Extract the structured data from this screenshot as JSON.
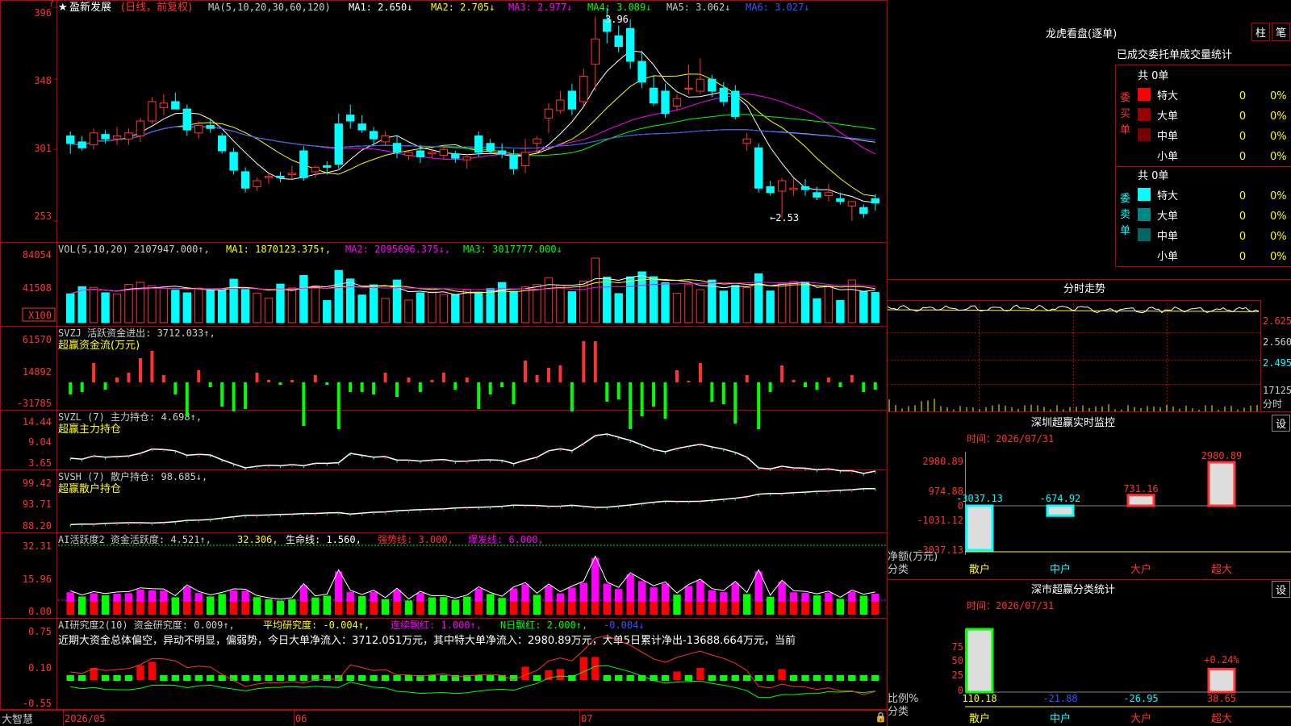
{
  "stock_title": "盈新发展",
  "stock_mode": "(日线，前复权)",
  "ma_header": {
    "label": "MA(5,10,20,30,60,120)",
    "ma1": "MA1: 2.650↓",
    "ma2": "MA2: 2.705↓",
    "ma3": "MA3: 2.977↓",
    "ma4": "MA4: 3.089↓",
    "ma5": "MA5: 3.062↓",
    "ma6": "MA6: 3.027↓"
  },
  "price_axis": [
    "396",
    "348",
    "301",
    "253"
  ],
  "price_annot": {
    "high": "3.96",
    "low": "←2.53"
  },
  "vol_header": {
    "label": "VOL(5,10,20) 2107947.000↑,",
    "ma1": "MA1: 1870123.375↑,",
    "ma2": "MA2: 2095696.375↓,",
    "ma3": "MA3: 3017777.000↓"
  },
  "vol_axis": [
    "84054",
    "41508"
  ],
  "vol_unit": "X100",
  "svzj_header": {
    "label": "SVZJ  活跃资金进出: 3712.033↑,",
    "name": "超赢资金流(万元)"
  },
  "svzj_axis": [
    "61570",
    "14892",
    "-31785"
  ],
  "svzl_header": {
    "label": "SVZL (7) 主力持仓: 4.698↑,",
    "name": "超赢主力持仓"
  },
  "svzl_axis": [
    "14.44",
    "9.04",
    "3.65"
  ],
  "svsh_header": {
    "label": "SVSH (7) 散户持仓: 98.685↓,",
    "name": "超赢散户持仓"
  },
  "svsh_axis": [
    "99.42",
    "93.71",
    "88.20"
  ],
  "ai1_header": {
    "label": "AI活跃度2 资金活跃度: 4.521↑,",
    "v2": "32.306,",
    "life": "生命线: 1.560,",
    "strong": "强势线: 3.000,",
    "burst": "爆发线: 6.000,"
  },
  "ai1_axis": [
    "32.31",
    "15.96",
    "0.00"
  ],
  "ai2_header": {
    "label": "AI研究度2(10) 资金研究度: 0.009↑,",
    "avg": "平均研究度: -0.004↑,",
    "cont": "连续飘红: 1.000↑,",
    "nday": "N日飘红: 2.000↑,",
    "last": "-0.004↓"
  },
  "ai2_text": "近期大资金总体偏空，异动不明显，偏弱势，今日大单净流入：3712.051万元，其中特大单净流入：2980.89万元，大单5日累计净出-13688.664万元，当前",
  "ai2_axis": [
    "0.75",
    "0.10",
    "-0.55"
  ],
  "date_axis": [
    "2026/05",
    "06",
    "07"
  ],
  "brand": "大智慧",
  "dragon_title": "龙虎看盘(逐单)",
  "btn_bar": "柱",
  "btn_pen": "笔",
  "order_title": "已成交委托单成交量统计",
  "buy_side": {
    "label": "委买单",
    "count": "共 0单",
    "rows": [
      {
        "name": "特大",
        "val": "0",
        "pct": "0%",
        "color": "#ff0000"
      },
      {
        "name": "大单",
        "val": "0",
        "pct": "0%",
        "color": "#990000"
      },
      {
        "name": "中单",
        "val": "0",
        "pct": "0%",
        "color": "#770000"
      },
      {
        "name": "小单",
        "val": "0",
        "pct": "0%",
        "color": "#000000"
      }
    ]
  },
  "sell_side": {
    "label": "委卖单",
    "count": "共 0单",
    "rows": [
      {
        "name": "特大",
        "val": "0",
        "pct": "0%",
        "color": "#00ffff"
      },
      {
        "name": "大单",
        "val": "0",
        "pct": "0%",
        "color": "#008888"
      },
      {
        "name": "中单",
        "val": "0",
        "pct": "0%",
        "color": "#006666"
      },
      {
        "name": "小单",
        "val": "0",
        "pct": "0%",
        "color": "#000000"
      }
    ]
  },
  "intraday_title": "分时走势",
  "intraday_axis": [
    "2.625",
    "2.560",
    "2.495",
    "17125",
    "分时"
  ],
  "sz_monitor": {
    "title": "深圳超赢实时监控",
    "set": "设",
    "time": "时间：2026/07/31",
    "axis": [
      "2980.89",
      "974.88",
      "0",
      "-1031.12",
      "-3037.13"
    ],
    "ylabel": "净额(万元)",
    "xlabel": "分类",
    "cats": [
      "散户",
      "中户",
      "大户",
      "超大"
    ],
    "values": [
      -3037.13,
      -674.92,
      731.16,
      2980.89
    ],
    "labels": [
      "-3037.13",
      "-674.92",
      "731.16",
      "2980.89"
    ]
  },
  "sz_class": {
    "title": "深市超赢分类统计",
    "set": "设",
    "time": "时间：2026/07/31",
    "axis": [
      "75",
      "50",
      "25",
      "0"
    ],
    "ylabel": "比例%",
    "xlabel": "分类",
    "cats": [
      "散户",
      "中户",
      "大户",
      "超大"
    ],
    "values": [
      110.18,
      -21.88,
      -26.95,
      38.65
    ],
    "labels": [
      "110.18",
      "-21.88",
      "-26.95",
      "38.65"
    ],
    "annot": "+0.24%"
  },
  "colors": {
    "up": "#ff3333",
    "down": "#00ffff",
    "grid": "#c00000",
    "ma1": "#ffffff",
    "ma2": "#ffff00",
    "ma3": "#ff00ff",
    "ma4": "#00ff00",
    "ma5": "#cccccc",
    "ma6": "#3355ff"
  },
  "chart_data": {
    "type": "candlestick",
    "ohlc": [
      [
        3.1,
        3.13,
        2.98,
        3.05
      ],
      [
        3.06,
        3.1,
        3.0,
        3.02
      ],
      [
        3.04,
        3.15,
        3.01,
        3.12
      ],
      [
        3.11,
        3.14,
        3.05,
        3.08
      ],
      [
        3.08,
        3.16,
        3.04,
        3.1
      ],
      [
        3.08,
        3.15,
        3.04,
        3.12
      ],
      [
        3.1,
        3.22,
        3.06,
        3.2
      ],
      [
        3.2,
        3.36,
        3.18,
        3.33
      ],
      [
        3.29,
        3.38,
        3.24,
        3.32
      ],
      [
        3.33,
        3.39,
        3.28,
        3.28
      ],
      [
        3.28,
        3.31,
        3.1,
        3.14
      ],
      [
        3.12,
        3.2,
        3.08,
        3.17
      ],
      [
        3.17,
        3.21,
        3.12,
        3.15
      ],
      [
        3.1,
        3.12,
        2.98,
        3.0
      ],
      [
        2.99,
        3.02,
        2.84,
        2.87
      ],
      [
        2.86,
        2.89,
        2.72,
        2.75
      ],
      [
        2.76,
        2.82,
        2.73,
        2.8
      ],
      [
        2.82,
        2.85,
        2.78,
        2.83
      ],
      [
        2.83,
        2.86,
        2.79,
        2.82
      ],
      [
        2.84,
        2.9,
        2.81,
        2.85
      ],
      [
        3.0,
        3.03,
        2.8,
        2.82
      ],
      [
        2.86,
        2.9,
        2.82,
        2.89
      ],
      [
        2.9,
        2.93,
        2.84,
        2.89
      ],
      [
        3.18,
        3.25,
        2.88,
        2.91
      ],
      [
        3.24,
        3.31,
        3.15,
        3.2
      ],
      [
        3.18,
        3.24,
        3.12,
        3.14
      ],
      [
        3.13,
        3.16,
        3.04,
        3.08
      ],
      [
        3.06,
        3.13,
        3.04,
        3.1
      ],
      [
        3.05,
        3.1,
        2.95,
        2.99
      ],
      [
        2.97,
        3.0,
        2.94,
        2.99
      ],
      [
        3.0,
        3.04,
        2.92,
        2.96
      ],
      [
        2.98,
        3.02,
        2.95,
        2.99
      ],
      [
        2.97,
        3.03,
        2.94,
        3.01
      ],
      [
        2.98,
        3.0,
        2.92,
        2.95
      ],
      [
        2.94,
        2.98,
        2.88,
        2.96
      ],
      [
        3.1,
        3.13,
        2.96,
        2.99
      ],
      [
        3.05,
        3.08,
        2.98,
        3.0
      ],
      [
        3.0,
        3.05,
        2.95,
        2.98
      ],
      [
        2.97,
        3.01,
        2.84,
        2.88
      ],
      [
        2.9,
        3.08,
        2.85,
        2.99
      ],
      [
        3.05,
        3.1,
        2.98,
        3.08
      ],
      [
        3.22,
        3.32,
        3.12,
        3.28
      ],
      [
        3.27,
        3.4,
        3.25,
        3.34
      ],
      [
        3.4,
        3.45,
        3.24,
        3.28
      ],
      [
        3.33,
        3.55,
        3.3,
        3.5
      ],
      [
        3.58,
        3.9,
        3.4,
        3.75
      ],
      [
        3.88,
        3.96,
        3.72,
        3.8
      ],
      [
        3.77,
        3.84,
        3.66,
        3.7
      ],
      [
        3.82,
        3.88,
        3.55,
        3.6
      ],
      [
        3.6,
        3.67,
        3.42,
        3.46
      ],
      [
        3.42,
        3.5,
        3.3,
        3.32
      ],
      [
        3.4,
        3.45,
        3.22,
        3.25
      ],
      [
        3.3,
        3.38,
        3.27,
        3.35
      ],
      [
        3.42,
        3.58,
        3.38,
        3.42
      ],
      [
        3.4,
        3.62,
        3.38,
        3.48
      ],
      [
        3.48,
        3.51,
        3.36,
        3.4
      ],
      [
        3.42,
        3.46,
        3.3,
        3.33
      ],
      [
        3.4,
        3.44,
        3.21,
        3.23
      ],
      [
        3.05,
        3.12,
        3.0,
        3.08
      ],
      [
        3.02,
        3.05,
        2.72,
        2.75
      ],
      [
        2.76,
        2.8,
        2.7,
        2.72
      ],
      [
        2.73,
        2.82,
        2.55,
        2.8
      ],
      [
        2.74,
        2.82,
        2.7,
        2.75
      ],
      [
        2.76,
        2.81,
        2.7,
        2.74
      ],
      [
        2.72,
        2.76,
        2.67,
        2.69
      ],
      [
        2.7,
        2.78,
        2.66,
        2.72
      ],
      [
        2.68,
        2.72,
        2.64,
        2.66
      ],
      [
        2.63,
        2.66,
        2.53,
        2.66
      ],
      [
        2.62,
        2.64,
        2.55,
        2.58
      ],
      [
        2.68,
        2.71,
        2.6,
        2.65
      ]
    ],
    "price_range": [
      2.4,
      4.0
    ]
  }
}
